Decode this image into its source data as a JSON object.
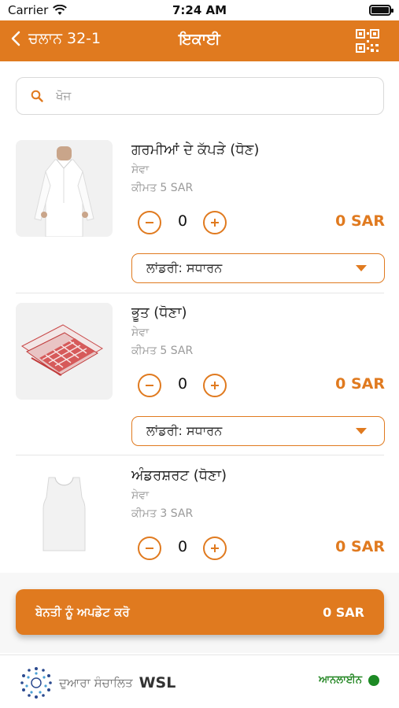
{
  "status_bar": {
    "carrier": "Carrier",
    "time": "7:24 AM"
  },
  "nav": {
    "back_label": "ਚਲਾਨ 32-1",
    "title": "ਇਕਾਈ",
    "qr_icon": "qr-code-icon"
  },
  "search": {
    "placeholder": "ਖੋਜ"
  },
  "items": [
    {
      "name": "ਗਰਮੀਆਂ ਦੇ ਕੱਪੜੇ (ਧੋਣ)",
      "type": "ਸੇਵਾ",
      "price": "ਕੀਮਤ 5 SAR",
      "qty": "0",
      "total": "0 SAR",
      "option": "ਲਾਂਡਰੀ: ਸਧਾਰਨ"
    },
    {
      "name": "ਭੂਤ (ਧੋਣਾ)",
      "type": "ਸੇਵਾ",
      "price": "ਕੀਮਤ 5 SAR",
      "qty": "0",
      "total": "0 SAR",
      "option": "ਲਾਂਡਰੀ: ਸਧਾਰਨ"
    },
    {
      "name": "ਅੰਡਰਸ਼ਰਟ (ਧੋਣਾ)",
      "type": "ਸੇਵਾ",
      "price": "ਕੀਮਤ 3 SAR",
      "qty": "0",
      "total": "0 SAR"
    }
  ],
  "submit": {
    "label": "ਬੇਨਤੀ ਨੂੰ ਅਪਡੇਟ ਕਰੋ",
    "amount": "0 SAR"
  },
  "footer": {
    "powered_by": "ਦੁਆਰਾ ਸੰਚਾਲਿਤ",
    "brand": "WSL",
    "status": "ਆਨਲਾਈਨ"
  },
  "colors": {
    "accent": "#e07a1f",
    "online": "#1d8a24"
  }
}
